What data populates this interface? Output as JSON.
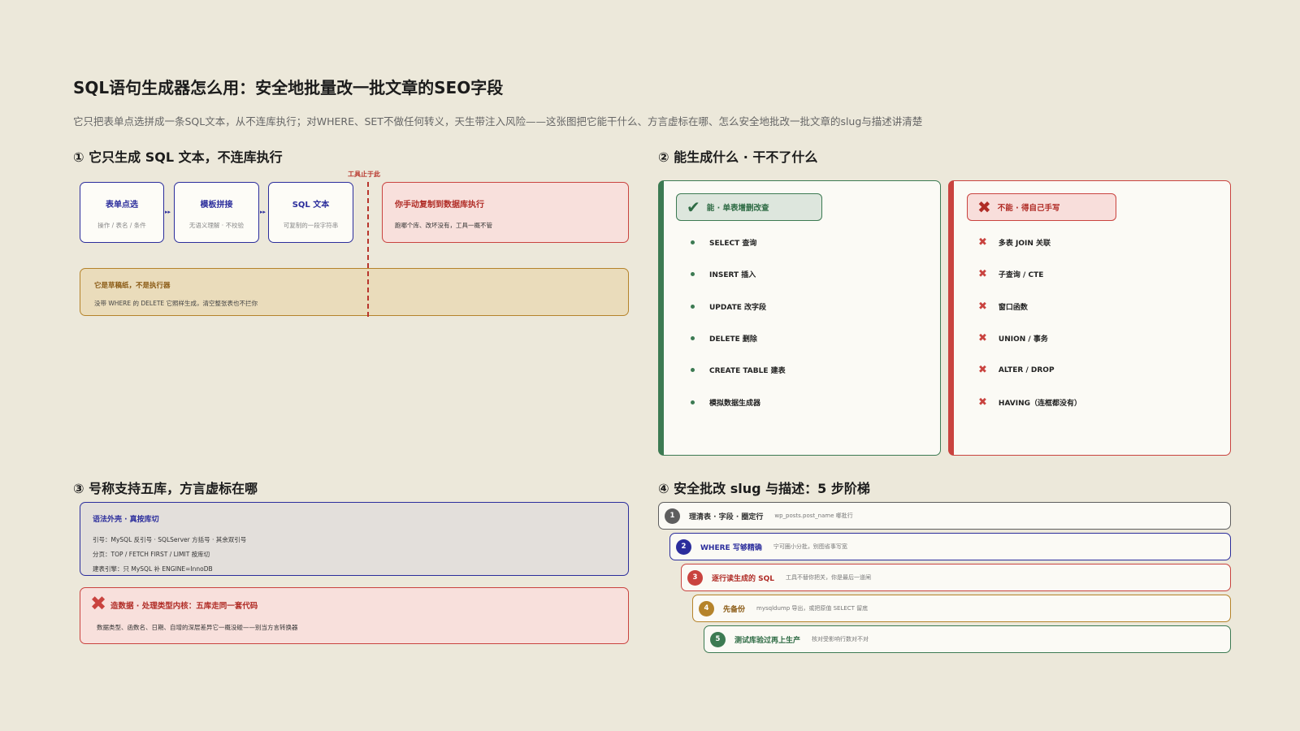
{
  "header": {
    "title": "SQL语句生成器怎么用：安全地批量改一批文章的SEO字段",
    "subtitle": "它只把表单点选拼成一条SQL文本，从不连库执行；对WHERE、SET不做任何转义，天生带注入风险——这张图把它能干什么、方言虚标在哪、怎么安全地批改一批文章的slug与描述讲清楚"
  },
  "section1": {
    "heading": "① 它只生成 SQL 文本，不连库执行",
    "flow": [
      {
        "title": "表单点选",
        "desc": "操作 / 表名 / 条件"
      },
      {
        "title": "模板拼接",
        "desc": "无语义理解 · 不校验"
      },
      {
        "title": "SQL 文本",
        "desc": "可复制的一段字符串"
      }
    ],
    "stop_label": "工具止于此",
    "manual": {
      "title": "你手动复制到数据库执行",
      "desc": "跑哪个库、改坏没有，工具一概不管"
    },
    "draft": {
      "title": "它是草稿纸，不是执行器",
      "desc": "没带 WHERE 的 DELETE 它照样生成，清空整张表也不拦你"
    }
  },
  "section2": {
    "heading": "② 能生成什么 · 干不了什么",
    "can": {
      "icon": "check-icon",
      "title": "能 · 单表增删改查",
      "items": [
        "SELECT 查询",
        "INSERT 插入",
        "UPDATE 改字段",
        "DELETE 删除",
        "CREATE TABLE 建表",
        "模拟数据生成器"
      ]
    },
    "cannot": {
      "icon": "cross-icon",
      "title": "不能 · 得自己手写",
      "items": [
        "多表 JOIN 关联",
        "子查询 / CTE",
        "窗口函数",
        "UNION / 事务",
        "ALTER / DROP",
        "HAVING（连框都没有）"
      ]
    }
  },
  "section3": {
    "heading": "③ 号称支持五库，方言虚标在哪",
    "dialect": {
      "title": "语法外壳 · 真按库切",
      "lines": [
        "引号：MySQL 反引号 · SQLServer 方括号 · 其余双引号",
        "分页：TOP / FETCH FIRST / LIMIT 按库切",
        "建表引擎：只 MySQL 补 ENGINE=InnoDB"
      ]
    },
    "fake": {
      "title": "造数据 · 处理类型内核：五库走同一套代码",
      "desc": "数据类型、函数名、日期、自增的深层差异它一概没碰——别当方言转换器"
    }
  },
  "section4": {
    "heading": "④ 安全批改 slug 与描述：5 步阶梯",
    "steps": [
      {
        "num": "1",
        "title": "理清表 · 字段 · 圈定行",
        "desc": "wp_posts.post_name 哪批行",
        "color": "#5e5e5e"
      },
      {
        "num": "2",
        "title": "WHERE 写够精确",
        "desc": "宁可圈小分批，别图省事写宽",
        "color": "#2b2d9c"
      },
      {
        "num": "3",
        "title": "逐行读生成的 SQL",
        "desc": "工具不替你把关，你是最后一道闸",
        "color": "#c9433f"
      },
      {
        "num": "4",
        "title": "先备份",
        "desc": "mysqldump 导出，或把原值 SELECT 留底",
        "color": "#b5832a"
      },
      {
        "num": "5",
        "title": "测试库验过再上生产",
        "desc": "核对受影响行数对不对",
        "color": "#3c7a52"
      }
    ]
  }
}
